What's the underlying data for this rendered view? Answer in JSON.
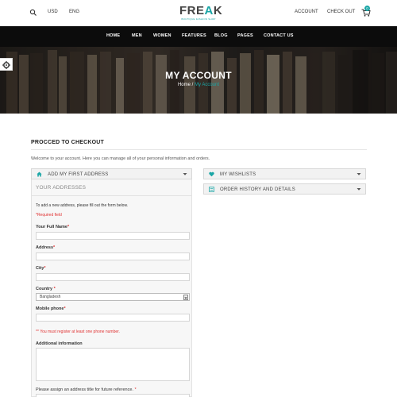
{
  "topbar": {
    "currency": "USD",
    "language": "ENG",
    "account_label": "ACCOUNT",
    "checkout_label": "CHECK OUT",
    "cart_count": "0"
  },
  "logo": {
    "word_main": "FRE",
    "word_accent": "A",
    "word_end": "K",
    "tagline": "BOUTIQUE FASHION SHOP"
  },
  "nav": {
    "items": [
      {
        "label": "HOME"
      },
      {
        "label": "MEN"
      },
      {
        "label": "WOMEN"
      },
      {
        "label": "FEATURES"
      },
      {
        "label": "BLOG"
      },
      {
        "label": "PAGES"
      },
      {
        "label": "CONTACT US"
      }
    ]
  },
  "hero": {
    "title": "MY ACCOUNT",
    "crumb_home": "Home",
    "crumb_sep": " / ",
    "crumb_current": "My Account"
  },
  "section": {
    "title": "PROCCED TO CHECKOUT",
    "welcome": "Welcome to your account. Here you can manage all of your personal information and orders."
  },
  "panels": {
    "add_address": "ADD MY FIRST ADDRESS",
    "wishlists": "MY WISHLISTS",
    "order_history": "ORDER HISTORY AND DETAILS"
  },
  "form": {
    "subheading": "YOUR ADDRESSES",
    "intro": "To add a new address, please fill out the form below.",
    "required_note": "*Required field",
    "full_name_label": "Your Full Name",
    "address_label": "Address",
    "city_label": "City",
    "country_label": "Country",
    "country_value": "Bangladesh",
    "mobile_label": "Mobile phone",
    "phone_note": "** You must register at least one phone number.",
    "additional_label": "Additional information",
    "alias_label": "Please assign an address title for future reference.",
    "asterisk": "*"
  },
  "colors": {
    "accent": "#1aa6a6",
    "nav_bg": "#0c0c0c",
    "required": "#e03131"
  },
  "icons": [
    "search-icon",
    "cart-icon",
    "gear-icon",
    "home-icon",
    "heart-icon",
    "list-icon",
    "chevron-down-icon"
  ]
}
